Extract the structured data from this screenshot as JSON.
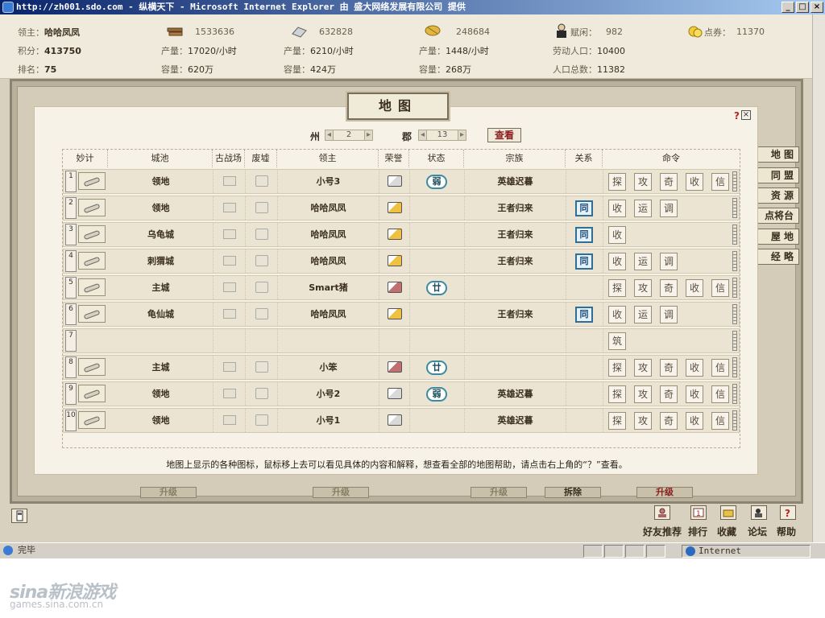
{
  "window": {
    "title": "http://zh001.sdo.com - 纵横天下 - Microsoft Internet Explorer 由 盛大网络发展有限公司 提供",
    "buttons": [
      "_",
      "□",
      "×"
    ]
  },
  "player": {
    "lord_label": "领主：",
    "lord_name": "哈哈凤凤",
    "score_label": "积分：",
    "score": "413750",
    "rank_label": "排名：",
    "rank": "75"
  },
  "resources": [
    {
      "icon": "wood-icon",
      "amount": "1533636",
      "prod_label": "产量：",
      "prod": "17020/小时",
      "cap_label": "容量：",
      "cap": "620万"
    },
    {
      "icon": "iron-icon",
      "amount": "632828",
      "prod_label": "产量：",
      "prod": "6210/小时",
      "cap_label": "容量：",
      "cap": "424万"
    },
    {
      "icon": "grain-icon",
      "amount": "248684",
      "prod_label": "产量：",
      "prod": "1448/小时",
      "cap_label": "容量：",
      "cap": "268万"
    }
  ],
  "population": {
    "idle_label": "赋闲：",
    "idle": "982",
    "labor_label": "劳动人口：",
    "labor": "10400",
    "total_label": "人口总数：",
    "total": "11382"
  },
  "points": {
    "label": "点券：",
    "value": "11370"
  },
  "side_buttons": [
    "地 图",
    "同 盟",
    "资 源",
    "点将台",
    "屋 地",
    "经 略"
  ],
  "dialog": {
    "title": "地图",
    "help": "?",
    "close": "×",
    "zhou_label": "州",
    "zhou_value": "2",
    "jun_label": "郡",
    "jun_value": "13",
    "view_button": "查看",
    "footnote": "地图上显示的各种图标，鼠标移上去可以看见具体的内容和解释，想查看全部的地图帮助，请点击右上角的“？”查看。"
  },
  "table": {
    "headers": [
      "妙计",
      "城池",
      "古战场",
      "废墟",
      "领主",
      "荣誉",
      "状态",
      "宗族",
      "关系",
      "命令"
    ],
    "rows": [
      {
        "num": "1",
        "city": "领地",
        "lord": "小号3",
        "state": "弱",
        "clan": "英雄迟暮",
        "rel": "",
        "cmds": [
          "探",
          "攻",
          "奇",
          "收",
          "信"
        ]
      },
      {
        "num": "2",
        "city": "领地",
        "lord": "哈哈凤凤",
        "state": "",
        "clan": "王者归来",
        "rel": "同",
        "cmds": [
          "收",
          "运",
          "调"
        ]
      },
      {
        "num": "3",
        "city": "乌龟城",
        "lord": "哈哈凤凤",
        "state": "",
        "clan": "王者归来",
        "rel": "同",
        "cmds": [
          "收"
        ]
      },
      {
        "num": "4",
        "city": "刺猬城",
        "lord": "哈哈凤凤",
        "state": "",
        "clan": "王者归来",
        "rel": "同",
        "cmds": [
          "收",
          "运",
          "调"
        ]
      },
      {
        "num": "5",
        "city": "主城",
        "lord": "Smart猪",
        "state": "廿",
        "clan": "",
        "rel": "",
        "cmds": [
          "探",
          "攻",
          "奇",
          "收",
          "信"
        ]
      },
      {
        "num": "6",
        "city": "龟仙城",
        "lord": "哈哈凤凤",
        "state": "",
        "clan": "王者归来",
        "rel": "同",
        "cmds": [
          "收",
          "运",
          "调"
        ]
      },
      {
        "num": "7",
        "city": "",
        "lord": "",
        "state": "",
        "clan": "",
        "rel": "",
        "cmds": [
          "筑"
        ]
      },
      {
        "num": "8",
        "city": "主城",
        "lord": "小笨",
        "state": "廿",
        "clan": "",
        "rel": "",
        "cmds": [
          "探",
          "攻",
          "奇",
          "收",
          "信"
        ]
      },
      {
        "num": "9",
        "city": "领地",
        "lord": "小号2",
        "state": "弱",
        "clan": "英雄迟暮",
        "rel": "",
        "cmds": [
          "探",
          "攻",
          "奇",
          "收",
          "信"
        ]
      },
      {
        "num": "10",
        "city": "领地",
        "lord": "小号1",
        "state": "",
        "clan": "英雄迟暮",
        "rel": "",
        "cmds": [
          "探",
          "攻",
          "奇",
          "收",
          "信"
        ]
      }
    ]
  },
  "under_buttons": [
    "升级",
    "升级",
    "升级",
    "拆除",
    "升级"
  ],
  "toolbar": [
    "好友推荐",
    "排行",
    "收藏",
    "论坛",
    "帮助"
  ],
  "status": {
    "text": "完毕",
    "zone": "Internet"
  },
  "watermark": {
    "logo": "sina新浪游戏",
    "url": "games.sina.com.cn"
  }
}
